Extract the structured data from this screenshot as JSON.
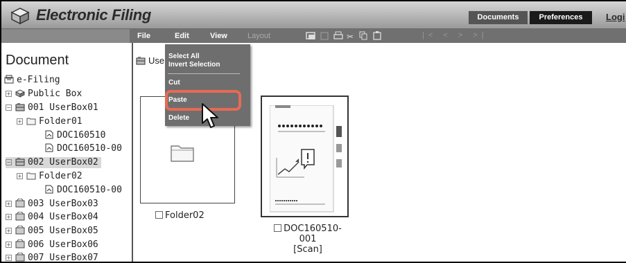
{
  "header": {
    "app_title": "Electronic Filing",
    "tabs": [
      "Documents",
      "Preferences"
    ],
    "logout": "Logi"
  },
  "menubar": {
    "items": [
      "File",
      "Edit",
      "View",
      "Layout"
    ],
    "nav": "|< < > >|"
  },
  "edit_menu": {
    "select_all": "Select All",
    "invert_selection": "Invert Selection",
    "cut": "Cut",
    "paste": "Paste",
    "delete": "Delete"
  },
  "sidebar": {
    "title": "Document",
    "tree": [
      {
        "label": "e-Filing",
        "icon": "efiling-icon"
      },
      {
        "label": "Public Box",
        "icon": "public-box-icon"
      },
      {
        "label": "001 UserBox01",
        "icon": "userbox-icon"
      },
      {
        "label": "Folder01",
        "icon": "folder-icon"
      },
      {
        "label": "DOC160510",
        "icon": "document-icon"
      },
      {
        "label": "DOC160510-00",
        "icon": "document-icon"
      },
      {
        "label": "002 UserBox02",
        "icon": "userbox-icon",
        "selected": true
      },
      {
        "label": "Folder02",
        "icon": "folder-icon"
      },
      {
        "label": "DOC160510-00",
        "icon": "document-icon"
      },
      {
        "label": "003 UserBox03",
        "icon": "userbox-icon"
      },
      {
        "label": "004 UserBox04",
        "icon": "userbox-icon"
      },
      {
        "label": "005 UserBox05",
        "icon": "userbox-icon"
      },
      {
        "label": "006 UserBox06",
        "icon": "userbox-icon"
      },
      {
        "label": "007 UserBox07",
        "icon": "userbox-icon"
      }
    ]
  },
  "content": {
    "breadcrumb": "User",
    "items": [
      {
        "name": "Folder02",
        "type": "folder"
      },
      {
        "name_lines": [
          "DOC160510-",
          "001",
          "[Scan]"
        ],
        "type": "document"
      }
    ]
  },
  "colors": {
    "highlight": "#e76a55",
    "menubar": "#707070",
    "dropdown": "#6e6e6e"
  }
}
